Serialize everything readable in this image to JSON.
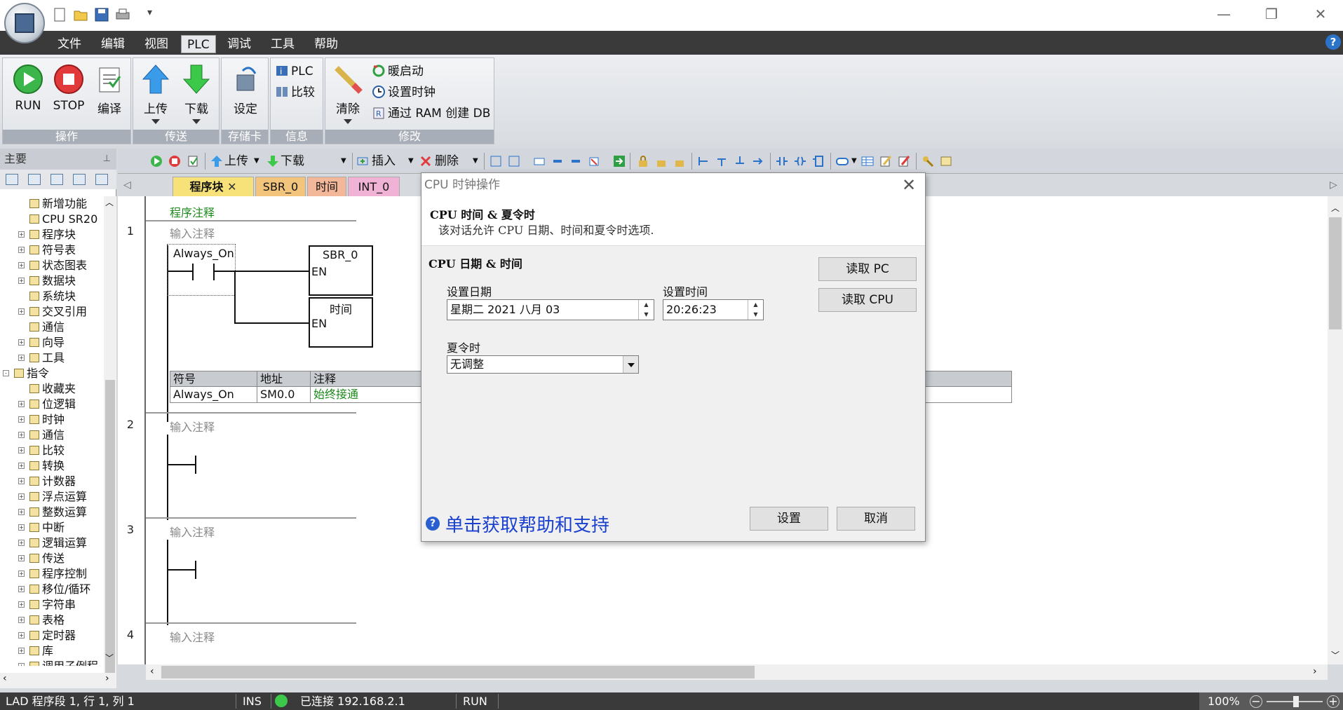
{
  "quick_access_icons": [
    "new-file-icon",
    "open-folder-icon",
    "save-icon",
    "print-icon"
  ],
  "menu": {
    "items": [
      "文件",
      "编辑",
      "视图",
      "PLC",
      "调试",
      "工具",
      "帮助"
    ],
    "active": "PLC",
    "help_glyph": "?"
  },
  "ribbon": {
    "groups": [
      {
        "title": "操作",
        "buttons": [
          "RUN",
          "STOP",
          "编译"
        ]
      },
      {
        "title": "传送",
        "buttons": [
          "上传",
          "下载"
        ]
      },
      {
        "title": "存储卡",
        "buttons": [
          "设定"
        ]
      },
      {
        "title": "信息",
        "small": [
          "PLC",
          "比较"
        ]
      },
      {
        "title": "修改",
        "big": "清除",
        "small": [
          "暖启动",
          "设置时钟",
          "通过 RAM 创建 DB"
        ]
      }
    ]
  },
  "left_panel": {
    "title": "主要",
    "tree": [
      {
        "label": "新增功能",
        "indent": 2,
        "exp": ""
      },
      {
        "label": "CPU SR20",
        "indent": 2,
        "exp": ""
      },
      {
        "label": "程序块",
        "indent": 2,
        "exp": "+"
      },
      {
        "label": "符号表",
        "indent": 2,
        "exp": "+"
      },
      {
        "label": "状态图表",
        "indent": 2,
        "exp": "+"
      },
      {
        "label": "数据块",
        "indent": 2,
        "exp": "+"
      },
      {
        "label": "系统块",
        "indent": 2,
        "exp": ""
      },
      {
        "label": "交叉引用",
        "indent": 2,
        "exp": "+"
      },
      {
        "label": "通信",
        "indent": 2,
        "exp": ""
      },
      {
        "label": "向导",
        "indent": 2,
        "exp": "+"
      },
      {
        "label": "工具",
        "indent": 2,
        "exp": "+"
      },
      {
        "label": "指令",
        "indent": 1,
        "exp": "-"
      },
      {
        "label": "收藏夹",
        "indent": 2,
        "exp": ""
      },
      {
        "label": "位逻辑",
        "indent": 2,
        "exp": "+"
      },
      {
        "label": "时钟",
        "indent": 2,
        "exp": "+"
      },
      {
        "label": "通信",
        "indent": 2,
        "exp": "+"
      },
      {
        "label": "比较",
        "indent": 2,
        "exp": "+"
      },
      {
        "label": "转换",
        "indent": 2,
        "exp": "+"
      },
      {
        "label": "计数器",
        "indent": 2,
        "exp": "+"
      },
      {
        "label": "浮点运算",
        "indent": 2,
        "exp": "+"
      },
      {
        "label": "整数运算",
        "indent": 2,
        "exp": "+"
      },
      {
        "label": "中断",
        "indent": 2,
        "exp": "+"
      },
      {
        "label": "逻辑运算",
        "indent": 2,
        "exp": "+"
      },
      {
        "label": "传送",
        "indent": 2,
        "exp": "+"
      },
      {
        "label": "程序控制",
        "indent": 2,
        "exp": "+"
      },
      {
        "label": "移位/循环",
        "indent": 2,
        "exp": "+"
      },
      {
        "label": "字符串",
        "indent": 2,
        "exp": "+"
      },
      {
        "label": "表格",
        "indent": 2,
        "exp": "+"
      },
      {
        "label": "定时器",
        "indent": 2,
        "exp": "+"
      },
      {
        "label": "库",
        "indent": 2,
        "exp": "+"
      },
      {
        "label": "调用子例程",
        "indent": 2,
        "exp": "+"
      }
    ]
  },
  "editor_toolbar": {
    "upload": "上传",
    "download": "下载",
    "insert": "插入",
    "delete": "删除"
  },
  "tabs": [
    {
      "label": "程序块",
      "color": "#f7e27a",
      "active": true
    },
    {
      "label": "SBR_0",
      "color": "#f3c47b"
    },
    {
      "label": "时间",
      "color": "#f3b89a"
    },
    {
      "label": "INT_0",
      "color": "#f0b3d6"
    }
  ],
  "program": {
    "comment": "程序注释",
    "networks": [
      {
        "num": "1",
        "comment": "输入注释"
      },
      {
        "num": "2",
        "comment": "输入注释"
      },
      {
        "num": "3",
        "comment": "输入注释"
      },
      {
        "num": "4",
        "comment": "输入注释"
      }
    ],
    "contact_label": "Always_On",
    "box1": {
      "title": "SBR_0",
      "pin": "EN"
    },
    "box2": {
      "title": "时间",
      "pin": "EN"
    },
    "symtable": {
      "headers": [
        "符号",
        "地址",
        "注释"
      ],
      "row": [
        "Always_On",
        "SM0.0",
        "始终接通"
      ]
    }
  },
  "dialog": {
    "title": "CPU 时钟操作",
    "heading": "CPU 时间 & 夏令时",
    "description": "该对话允许 CPU 日期、时间和夏令时选项.",
    "section": "CPU 日期 & 时间",
    "date_label": "设置日期",
    "date_value": "星期二 2021  八月  03",
    "time_label": "设置时间",
    "time_value": "20:26:23",
    "dst_label": "夏令时",
    "dst_value": "无调整",
    "read_pc": "读取 PC",
    "read_cpu": "读取 CPU",
    "help": "单击获取帮助和支持",
    "set": "设置",
    "cancel": "取消"
  },
  "status": {
    "position": "LAD 程序段 1, 行 1, 列 1",
    "mode": "INS",
    "connection": "已连接 192.168.2.1",
    "cpu_state": "RUN",
    "zoom": "100%"
  },
  "colors": {
    "accent": "#2a73c9",
    "menubar": "#3a3a3a",
    "connected": "#3cc94a"
  }
}
